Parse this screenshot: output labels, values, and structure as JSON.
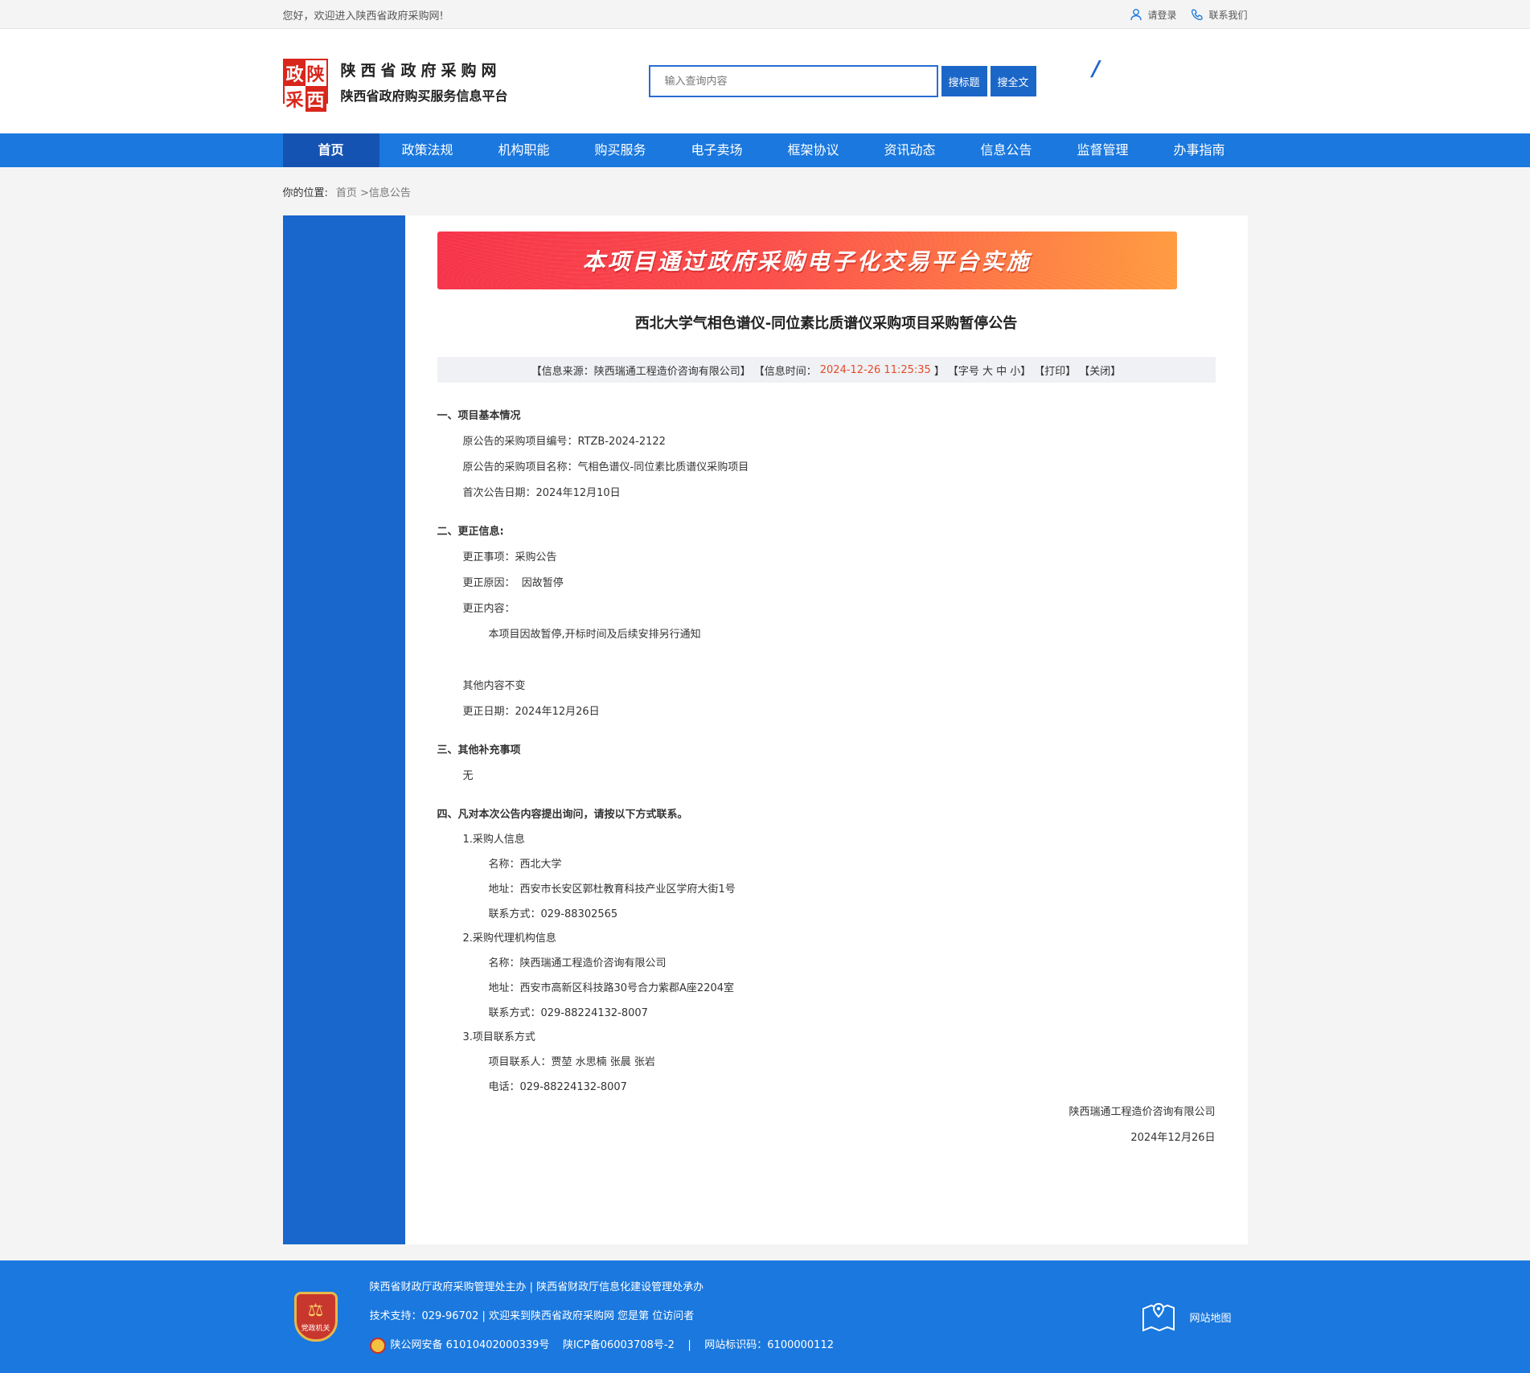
{
  "topbar": {
    "welcome": "您好，欢迎进入陕西省政府采购网!",
    "login": "请登录",
    "contact": "联系我们"
  },
  "logo": {
    "chars": [
      "政",
      "陕",
      "采",
      "西"
    ],
    "line1": "陕西省政府采购网",
    "line2": "陕西省政府购买服务信息平台"
  },
  "search": {
    "placeholder": "输入查询内容",
    "btn_title": "搜标题",
    "btn_full": "搜全文"
  },
  "nav": [
    "首页",
    "政策法规",
    "机构职能",
    "购买服务",
    "电子卖场",
    "框架协议",
    "资讯动态",
    "信息公告",
    "监督管理",
    "办事指南"
  ],
  "breadcrumb": {
    "label": "你的位置:",
    "path": "首页 >信息公告"
  },
  "banner": "本项目通过政府采购电子化交易平台实施",
  "article": {
    "title": "西北大学气相色谱仪-同位素比质谱仪采购项目采购暂停公告",
    "meta_source": "【信息来源：陕西瑞通工程造价咨询有限公司】",
    "meta_time_label": "【信息时间：",
    "meta_time": "2024-12-26 11:25:35",
    "meta_time_end": "】",
    "meta_font": "【字号 大 中 小】",
    "meta_print": "【打印】",
    "meta_close": "【关闭】",
    "s1_title": "一、项目基本情况",
    "s1_l1": "原公告的采购项目编号：RTZB-2024-2122",
    "s1_l2": "原公告的采购项目名称：气相色谱仪-同位素比质谱仪采购项目",
    "s1_l3": "首次公告日期：2024年12月10日",
    "s2_title": "二、更正信息:",
    "s2_l1": "更正事项：采购公告",
    "s2_l2": "更正原因：  因故暂停",
    "s2_l3": "更正内容：",
    "s2_l4": "本项目因故暂停,开标时间及后续安排另行通知",
    "s2_l5": "其他内容不变",
    "s2_l6": "更正日期：2024年12月26日",
    "s3_title": "三、其他补充事项",
    "s3_l1": "无",
    "s4_title": "四、凡对本次公告内容提出询问，请按以下方式联系。",
    "c1_title": "1.采购人信息",
    "c1_name": "名称：西北大学",
    "c1_addr": "地址：西安市长安区郭杜教育科技产业区学府大街1号",
    "c1_tel": "联系方式：029-88302565",
    "c2_title": "2.采购代理机构信息",
    "c2_name": "名称：陕西瑞通工程造价咨询有限公司",
    "c2_addr": "地址：西安市高新区科技路30号合力紫郡A座2204室",
    "c2_tel": "联系方式：029-88224132-8007",
    "c3_title": "3.项目联系方式",
    "c3_person": "项目联系人：贾堃 水思楠 张晨 张岩",
    "c3_tel": "电话：029-88224132-8007",
    "sign_org": "陕西瑞通工程造价咨询有限公司",
    "sign_date": "2024年12月26日"
  },
  "footer": {
    "badge_text": "党政机关",
    "line1": "陕西省财政厅政府采购管理处主办 | 陕西省财政厅信息化建设管理处承办",
    "line2": "技术支持：029-96702 | 欢迎来到陕西省政府采购网 您是第 位访问者",
    "line3": "陕公网安备 61010402000339号    陕ICP备06003708号-2    |    网站标识码：6100000112",
    "sitemap": "网站地图"
  },
  "colors": {
    "nav_bg": "#1a78de",
    "nav_active": "#1553b3",
    "accent_time": "#e64b2a",
    "logo_red": "#d9261c"
  }
}
